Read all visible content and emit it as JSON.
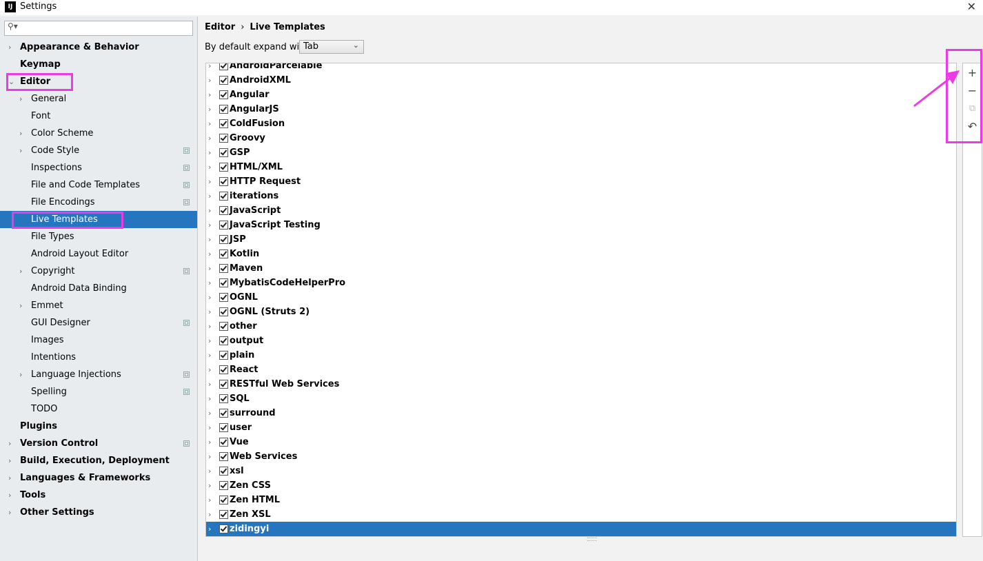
{
  "window": {
    "title": "Settings",
    "app_icon_label": "IJ",
    "close_glyph": "✕"
  },
  "search": {
    "placeholder": ""
  },
  "sidebar": {
    "items": [
      {
        "label": "Appearance & Behavior",
        "level": 0,
        "bold": true,
        "arrow": "›"
      },
      {
        "label": "Keymap",
        "level": 0,
        "bold": true
      },
      {
        "label": "Editor",
        "level": 0,
        "bold": true,
        "arrow": "⌄"
      },
      {
        "label": "General",
        "level": 1,
        "arrow": "›"
      },
      {
        "label": "Font",
        "level": 1
      },
      {
        "label": "Color Scheme",
        "level": 1,
        "arrow": "›"
      },
      {
        "label": "Code Style",
        "level": 1,
        "arrow": "›",
        "project": true
      },
      {
        "label": "Inspections",
        "level": 1,
        "project": true
      },
      {
        "label": "File and Code Templates",
        "level": 1,
        "project": true
      },
      {
        "label": "File Encodings",
        "level": 1,
        "project": true
      },
      {
        "label": "Live Templates",
        "level": 1,
        "selected": true
      },
      {
        "label": "File Types",
        "level": 1
      },
      {
        "label": "Android Layout Editor",
        "level": 1
      },
      {
        "label": "Copyright",
        "level": 1,
        "arrow": "›",
        "project": true
      },
      {
        "label": "Android Data Binding",
        "level": 1
      },
      {
        "label": "Emmet",
        "level": 1,
        "arrow": "›"
      },
      {
        "label": "GUI Designer",
        "level": 1,
        "project": true
      },
      {
        "label": "Images",
        "level": 1
      },
      {
        "label": "Intentions",
        "level": 1
      },
      {
        "label": "Language Injections",
        "level": 1,
        "arrow": "›",
        "project": true
      },
      {
        "label": "Spelling",
        "level": 1,
        "project": true
      },
      {
        "label": "TODO",
        "level": 1
      },
      {
        "label": "Plugins",
        "level": 0,
        "bold": true
      },
      {
        "label": "Version Control",
        "level": 0,
        "bold": true,
        "arrow": "›",
        "project": true
      },
      {
        "label": "Build, Execution, Deployment",
        "level": 0,
        "bold": true,
        "arrow": "›"
      },
      {
        "label": "Languages & Frameworks",
        "level": 0,
        "bold": true,
        "arrow": "›"
      },
      {
        "label": "Tools",
        "level": 0,
        "bold": true,
        "arrow": "›"
      },
      {
        "label": "Other Settings",
        "level": 0,
        "bold": true,
        "arrow": "›"
      }
    ]
  },
  "breadcrumb": {
    "parent": "Editor",
    "separator": "›",
    "current": "Live Templates"
  },
  "expand": {
    "label": "By default expand with",
    "value": "Tab",
    "chevron": "⌄"
  },
  "template_groups": [
    {
      "name": "AndroidParcelable",
      "checked": true
    },
    {
      "name": "AndroidXML",
      "checked": true
    },
    {
      "name": "Angular",
      "checked": true
    },
    {
      "name": "AngularJS",
      "checked": true
    },
    {
      "name": "ColdFusion",
      "checked": true
    },
    {
      "name": "Groovy",
      "checked": true
    },
    {
      "name": "GSP",
      "checked": true
    },
    {
      "name": "HTML/XML",
      "checked": true
    },
    {
      "name": "HTTP Request",
      "checked": true
    },
    {
      "name": "iterations",
      "checked": true
    },
    {
      "name": "JavaScript",
      "checked": true
    },
    {
      "name": "JavaScript Testing",
      "checked": true
    },
    {
      "name": "JSP",
      "checked": true
    },
    {
      "name": "Kotlin",
      "checked": true
    },
    {
      "name": "Maven",
      "checked": true
    },
    {
      "name": "MybatisCodeHelperPro",
      "checked": true
    },
    {
      "name": "OGNL",
      "checked": true
    },
    {
      "name": "OGNL (Struts 2)",
      "checked": true
    },
    {
      "name": "other",
      "checked": true
    },
    {
      "name": "output",
      "checked": true
    },
    {
      "name": "plain",
      "checked": true
    },
    {
      "name": "React",
      "checked": true
    },
    {
      "name": "RESTful Web Services",
      "checked": true
    },
    {
      "name": "SQL",
      "checked": true
    },
    {
      "name": "surround",
      "checked": true
    },
    {
      "name": "user",
      "checked": true
    },
    {
      "name": "Vue",
      "checked": true
    },
    {
      "name": "Web Services",
      "checked": true
    },
    {
      "name": "xsl",
      "checked": true
    },
    {
      "name": "Zen CSS",
      "checked": true
    },
    {
      "name": "Zen HTML",
      "checked": true
    },
    {
      "name": "Zen XSL",
      "checked": true
    },
    {
      "name": "zidingyi",
      "checked": true,
      "selected": true
    }
  ],
  "toolbar": {
    "add_glyph": "+",
    "remove_glyph": "−",
    "copy_glyph": "⧉",
    "restore_glyph": "↶"
  },
  "colors": {
    "selection": "#2675bf",
    "annotation": "#ec3ae4",
    "sidebar_bg": "#e9ecef"
  }
}
